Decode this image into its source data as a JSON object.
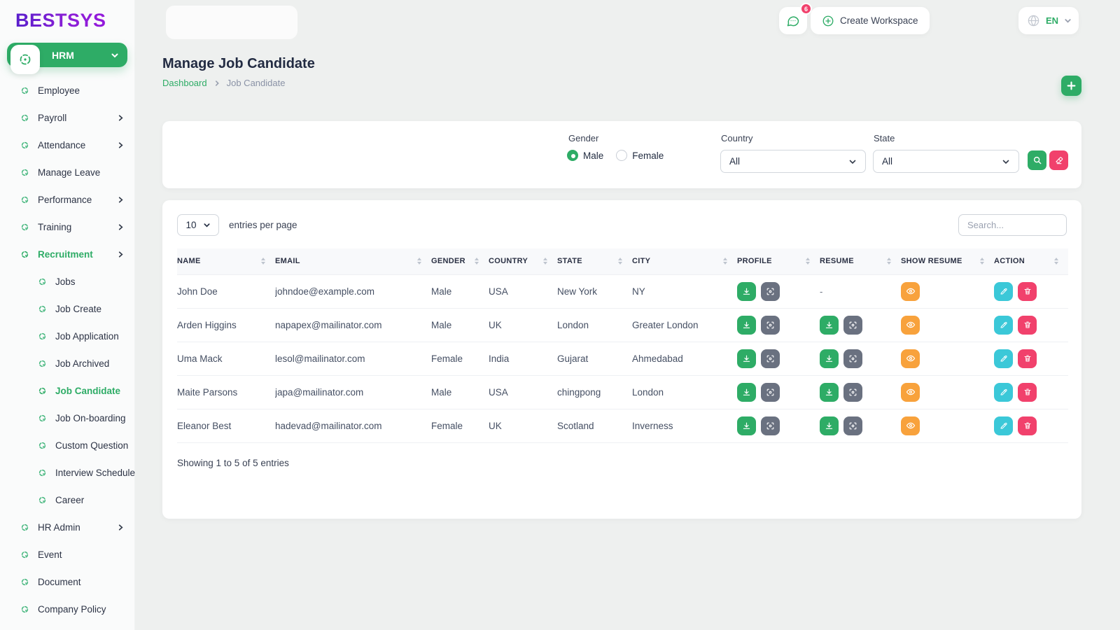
{
  "brand": {
    "logo_text": "BESTSYS"
  },
  "topbar": {
    "chat_badge_count": "6",
    "create_workspace_label": "Create Workspace",
    "language_code": "EN"
  },
  "sidebar": {
    "section_label": "HRM",
    "items": [
      {
        "label": "Employee",
        "sub": false,
        "chevron": false,
        "active": false
      },
      {
        "label": "Payroll",
        "sub": false,
        "chevron": true,
        "active": false
      },
      {
        "label": "Attendance",
        "sub": false,
        "chevron": true,
        "active": false
      },
      {
        "label": "Manage Leave",
        "sub": false,
        "chevron": false,
        "active": false
      },
      {
        "label": "Performance",
        "sub": false,
        "chevron": true,
        "active": false
      },
      {
        "label": "Training",
        "sub": false,
        "chevron": true,
        "active": false
      },
      {
        "label": "Recruitment",
        "sub": false,
        "chevron": true,
        "active": true
      },
      {
        "label": "Jobs",
        "sub": true,
        "chevron": false,
        "active": false
      },
      {
        "label": "Job Create",
        "sub": true,
        "chevron": false,
        "active": false
      },
      {
        "label": "Job Application",
        "sub": true,
        "chevron": false,
        "active": false
      },
      {
        "label": "Job Archived",
        "sub": true,
        "chevron": false,
        "active": false
      },
      {
        "label": "Job Candidate",
        "sub": true,
        "chevron": false,
        "active": true
      },
      {
        "label": "Job On-boarding",
        "sub": true,
        "chevron": false,
        "active": false
      },
      {
        "label": "Custom Question",
        "sub": true,
        "chevron": false,
        "active": false
      },
      {
        "label": "Interview Schedule",
        "sub": true,
        "chevron": false,
        "active": false
      },
      {
        "label": "Career",
        "sub": true,
        "chevron": false,
        "active": false
      },
      {
        "label": "HR Admin",
        "sub": false,
        "chevron": true,
        "active": false
      },
      {
        "label": "Event",
        "sub": false,
        "chevron": false,
        "active": false
      },
      {
        "label": "Document",
        "sub": false,
        "chevron": false,
        "active": false
      },
      {
        "label": "Company Policy",
        "sub": false,
        "chevron": false,
        "active": false
      }
    ]
  },
  "page": {
    "title": "Manage Job Candidate",
    "breadcrumb_home": "Dashboard",
    "breadcrumb_current": "Job Candidate"
  },
  "filters": {
    "gender_label": "Gender",
    "gender_options": [
      "Male",
      "Female"
    ],
    "gender_selected": "Male",
    "country_label": "Country",
    "country_value": "All",
    "state_label": "State",
    "state_value": "All"
  },
  "table": {
    "entries_per_page_value": "10",
    "entries_per_page_label": "entries per page",
    "search_placeholder": "Search...",
    "columns": [
      "NAME",
      "EMAIL",
      "GENDER",
      "COUNTRY",
      "STATE",
      "CITY",
      "PROFILE",
      "RESUME",
      "SHOW RESUME",
      "ACTION"
    ],
    "no_resume_placeholder": "-",
    "rows": [
      {
        "name": "John Doe",
        "email": "johndoe@example.com",
        "gender": "Male",
        "country": "USA",
        "state": "New York",
        "city": "NY",
        "has_resume": false
      },
      {
        "name": "Arden Higgins",
        "email": "napapex@mailinator.com",
        "gender": "Male",
        "country": "UK",
        "state": "London",
        "city": "Greater London",
        "has_resume": true
      },
      {
        "name": "Uma Mack",
        "email": "lesol@mailinator.com",
        "gender": "Female",
        "country": "India",
        "state": "Gujarat",
        "city": "Ahmedabad",
        "has_resume": true
      },
      {
        "name": "Maite Parsons",
        "email": "japa@mailinator.com",
        "gender": "Male",
        "country": "USA",
        "state": "chingpong",
        "city": "London",
        "has_resume": true
      },
      {
        "name": "Eleanor Best",
        "email": "hadevad@mailinator.com",
        "gender": "Female",
        "country": "UK",
        "state": "Scotland",
        "city": "Inverness",
        "has_resume": true
      }
    ],
    "footer_text": "Showing 1 to 5 of 5 entries"
  },
  "colors": {
    "primary_green": "#2eac66",
    "pink": "#f1416c",
    "teal": "#3bc8d8",
    "orange": "#f8a23c",
    "gray_button": "#6a7180",
    "logo_purple_start": "#4a1fc8",
    "logo_purple_end": "#9a16e0"
  }
}
